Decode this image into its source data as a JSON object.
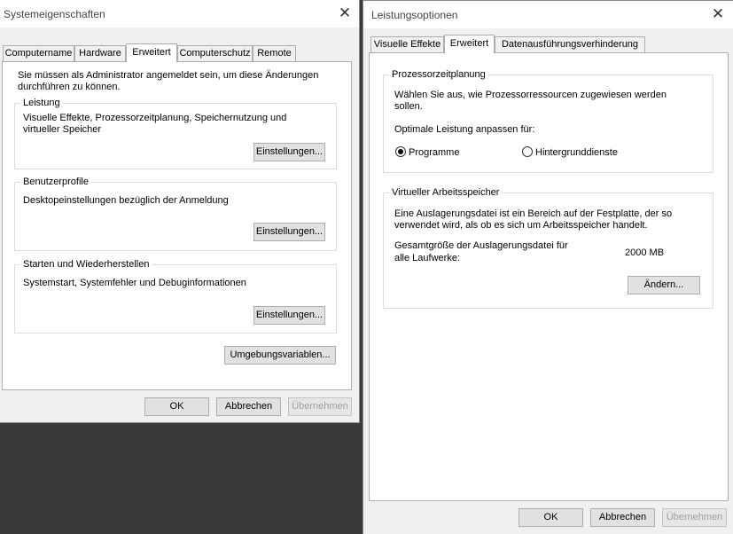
{
  "left": {
    "title": "Systemeigenschaften",
    "close_glyph": "✕",
    "tabs": [
      "Computername",
      "Hardware",
      "Erweitert",
      "Computerschutz",
      "Remote"
    ],
    "active_tab": "Erweitert",
    "admin_notice": "Sie müssen als Administrator angemeldet sein, um diese Änderungen durchführen zu können.",
    "groups": [
      {
        "title": "Leistung",
        "description": "Visuelle Effekte, Prozessorzeitplanung, Speichernutzung und virtueller Speicher",
        "button": "Einstellungen..."
      },
      {
        "title": "Benutzerprofile",
        "description": "Desktopeinstellungen bezüglich der Anmeldung",
        "button": "Einstellungen..."
      },
      {
        "title": "Starten und Wiederherstellen",
        "description": "Systemstart, Systemfehler und Debuginformationen",
        "button": "Einstellungen..."
      }
    ],
    "env_button": "Umgebungsvariablen...",
    "footer": {
      "ok": "OK",
      "cancel": "Abbrechen",
      "apply": "Übernehmen"
    }
  },
  "right": {
    "title": "Leistungsoptionen",
    "close_glyph": "✕",
    "tabs": [
      "Visuelle Effekte",
      "Erweitert",
      "Datenausführungsverhinderung"
    ],
    "active_tab": "Erweitert",
    "scheduling": {
      "title": "Prozessorzeitplanung",
      "description": "Wählen Sie aus, wie Prozessorressourcen zugewiesen werden sollen.",
      "adjust_label": "Optimale Leistung anpassen für:",
      "options": [
        {
          "label": "Programme",
          "checked": true
        },
        {
          "label": "Hintergrunddienste",
          "checked": false
        }
      ]
    },
    "virtual_memory": {
      "title": "Virtueller Arbeitsspeicher",
      "description": "Eine Auslagerungsdatei ist ein Bereich auf der Festplatte, der so verwendet wird, als ob es sich um Arbeitsspeicher handelt.",
      "total_label_line1": "Gesamtgröße der Auslagerungsdatei für",
      "total_label_line2": "alle Laufwerke:",
      "total_value": "2000 MB",
      "change_button": "Ändern..."
    },
    "footer": {
      "ok": "OK",
      "cancel": "Abbrechen",
      "apply": "Übernehmen"
    }
  }
}
